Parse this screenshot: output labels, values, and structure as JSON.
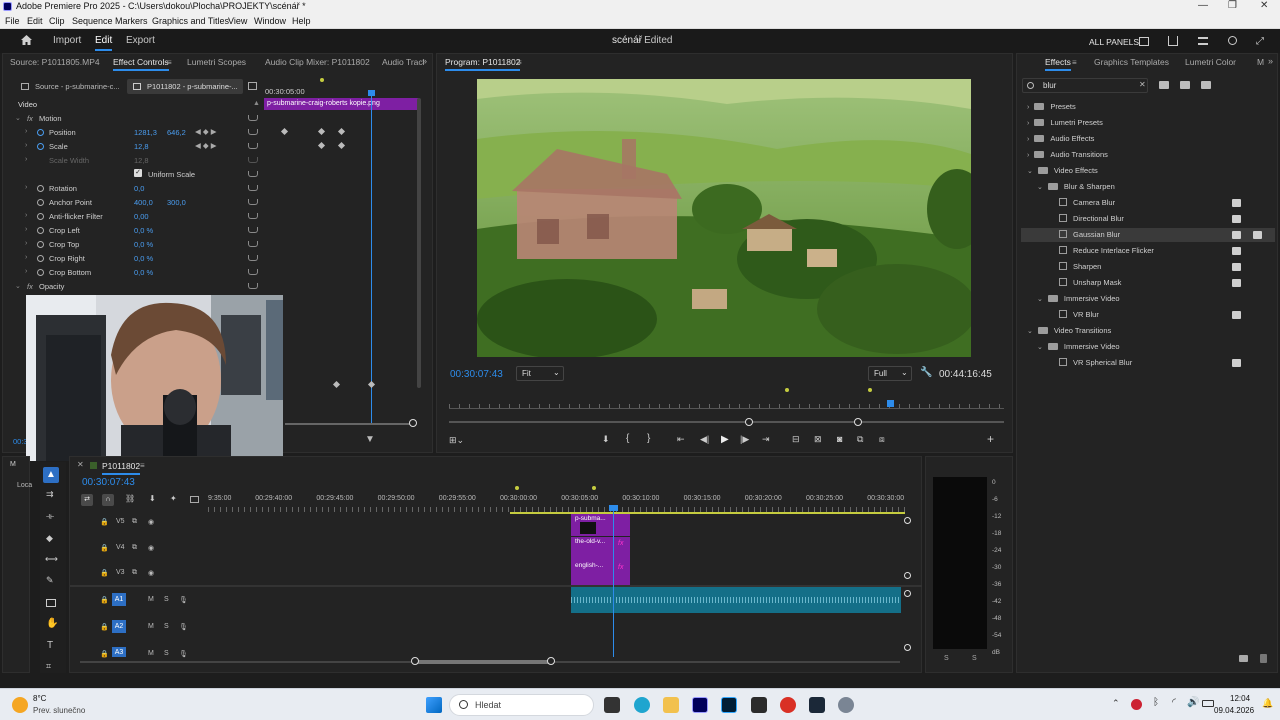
{
  "window": {
    "title": "Adobe Premiere Pro 2025 - C:\\Users\\dokou\\Plocha\\PROJEKTY\\scénář *"
  },
  "menu": [
    "File",
    "Edit",
    "Clip",
    "Sequence",
    "Markers",
    "Graphics and Titles",
    "View",
    "Window",
    "Help"
  ],
  "header": {
    "import": "Import",
    "edit": "Edit",
    "export": "Export",
    "project": "scénář",
    "status": "- Edited",
    "all_panels": "ALL PANELS"
  },
  "source_panel": {
    "tabs": [
      "Source: P1011805.MP4",
      "Effect Controls",
      "Lumetri Scopes",
      "Audio Clip Mixer: P1011802",
      "Audio Tracl"
    ],
    "clip_tabs": [
      "Source - p-submarine-c...",
      "P1011802 - p-submarine-..."
    ],
    "timecode": "00:30:05:00",
    "clip_label": "p-submarine-craig-roberts kopie.png",
    "section_video": "Video",
    "params": [
      {
        "name": "Motion",
        "value": ""
      },
      {
        "name": "Position",
        "value": "1281,3",
        "value2": "646,2"
      },
      {
        "name": "Scale",
        "value": "12,8"
      },
      {
        "name": "Scale Width",
        "value": "12,8"
      },
      {
        "name": "Uniform Scale",
        "value": ""
      },
      {
        "name": "Rotation",
        "value": "0,0"
      },
      {
        "name": "Anchor Point",
        "value": "400,0",
        "value2": "300,0"
      },
      {
        "name": "Anti-flicker Filter",
        "value": "0,00"
      },
      {
        "name": "Crop Left",
        "value": "0,0 %"
      },
      {
        "name": "Crop Top",
        "value": "0,0 %"
      },
      {
        "name": "Crop Right",
        "value": "0,0 %"
      },
      {
        "name": "Crop Bottom",
        "value": "0,0 %"
      },
      {
        "name": "Opacity",
        "value": ""
      }
    ],
    "bottom_timecode": "00:3"
  },
  "program_panel": {
    "title": "Program: P1011802",
    "timecode": "00:30:07:43",
    "fit": "Fit",
    "quality": "Full",
    "duration": "00:44:16:45"
  },
  "effects_panel": {
    "tabs": [
      "Effects",
      "Graphics Templates",
      "Lumetri Color",
      "M"
    ],
    "search_value": "blur",
    "tree": [
      {
        "label": "Presets",
        "type": "folder",
        "level": 0,
        "open": false
      },
      {
        "label": "Lumetri Presets",
        "type": "folder",
        "level": 0,
        "open": false
      },
      {
        "label": "Audio Effects",
        "type": "folder",
        "level": 0,
        "open": false
      },
      {
        "label": "Audio Transitions",
        "type": "folder",
        "level": 0,
        "open": false
      },
      {
        "label": "Video Effects",
        "type": "folder",
        "level": 0,
        "open": true
      },
      {
        "label": "Blur & Sharpen",
        "type": "folder",
        "level": 1,
        "open": true
      },
      {
        "label": "Camera Blur",
        "type": "effect",
        "level": 2
      },
      {
        "label": "Directional Blur",
        "type": "effect",
        "level": 2
      },
      {
        "label": "Gaussian Blur",
        "type": "effect",
        "level": 2,
        "selected": true
      },
      {
        "label": "Reduce Interlace Flicker",
        "type": "effect",
        "level": 2
      },
      {
        "label": "Sharpen",
        "type": "effect",
        "level": 2
      },
      {
        "label": "Unsharp Mask",
        "type": "effect",
        "level": 2
      },
      {
        "label": "Immersive Video",
        "type": "folder",
        "level": 1,
        "open": true
      },
      {
        "label": "VR Blur",
        "type": "effect",
        "level": 2
      },
      {
        "label": "Video Transitions",
        "type": "folder",
        "level": 0,
        "open": true
      },
      {
        "label": "Immersive Video",
        "type": "folder",
        "level": 1,
        "open": true
      },
      {
        "label": "VR Spherical Blur",
        "type": "effect",
        "level": 2
      }
    ]
  },
  "timeline": {
    "sequence_tab": "P1011802",
    "timecode": "00:30:07:43",
    "ruler": [
      "9:35:00",
      "00:29:40:00",
      "00:29:45:00",
      "00:29:50:00",
      "00:29:55:00",
      "00:30:00:00",
      "00:30:05:00",
      "00:30:10:00",
      "00:30:15:00",
      "00:30:20:00",
      "00:30:25:00",
      "00:30:30:00"
    ],
    "tracks": [
      "V5",
      "V4",
      "V3",
      "A1",
      "A2",
      "A3"
    ],
    "clips": [
      "p-subma...",
      "the-old-v...",
      "english-..."
    ],
    "meter_scale": [
      "0",
      "-6",
      "-12",
      "-18",
      "-24",
      "-30",
      "-36",
      "-42",
      "-48",
      "-54",
      "dB"
    ]
  },
  "taskbar": {
    "weather_temp": "8°C",
    "weather_desc": "Prev. slunečno",
    "search_placeholder": "Hledat",
    "time": "12:04",
    "date": "09.04.2026"
  },
  "colors": {
    "accent": "#2d8ceb",
    "clip_video": "#7e1fa3",
    "clip_audio": "#146f88",
    "value_blue": "#4a9df0"
  }
}
